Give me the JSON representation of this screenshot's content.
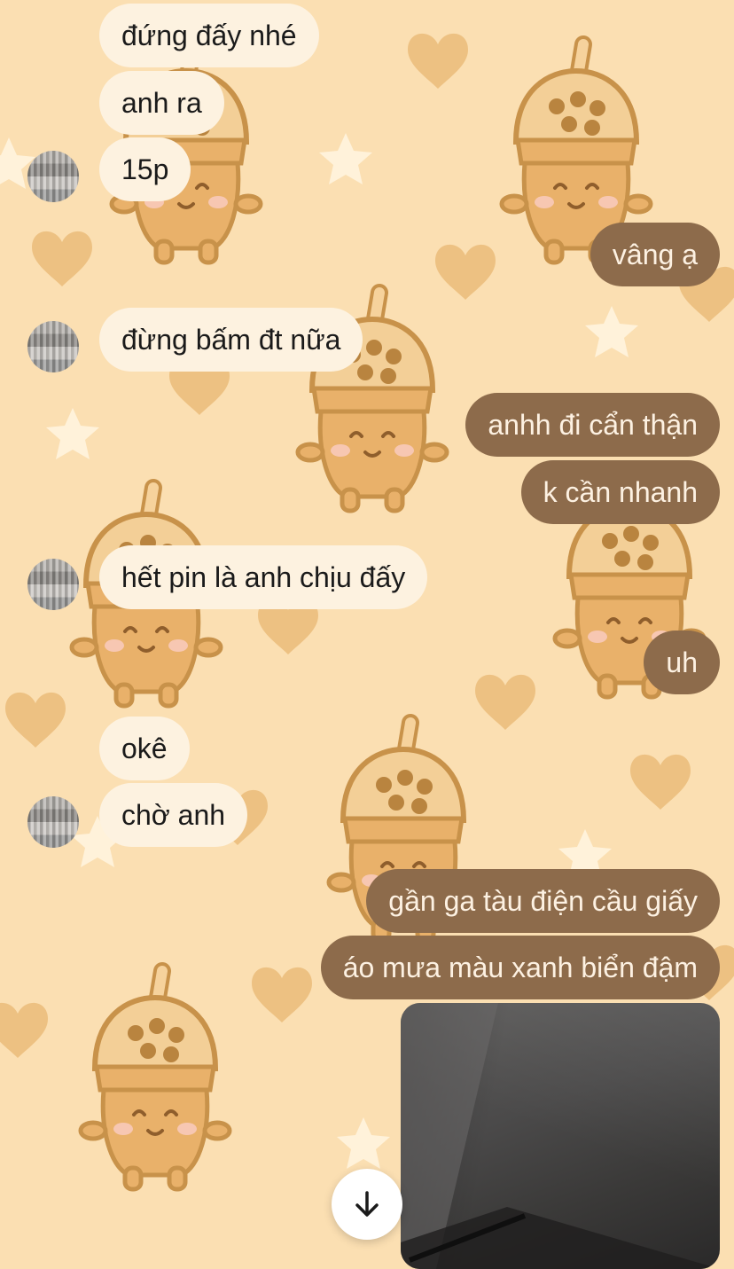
{
  "chat": {
    "messages": [
      {
        "dir": "in",
        "text": "đứng đấy nhé"
      },
      {
        "dir": "in",
        "text": "anh ra"
      },
      {
        "dir": "in",
        "text": "15p"
      },
      {
        "dir": "out",
        "text": "vâng ạ"
      },
      {
        "dir": "in",
        "text": "đừng bấm đt nữa"
      },
      {
        "dir": "out",
        "text": "anhh đi cẩn thận"
      },
      {
        "dir": "out",
        "text": "k cần nhanh"
      },
      {
        "dir": "in",
        "text": "hết pin là anh chịu đấy"
      },
      {
        "dir": "out",
        "text": "uh"
      },
      {
        "dir": "in",
        "text": "okê"
      },
      {
        "dir": "in",
        "text": "chờ anh"
      },
      {
        "dir": "out",
        "text": "gần ga tàu điện cầu giấy"
      },
      {
        "dir": "out",
        "text": "áo mưa màu xanh biển đậm"
      }
    ]
  },
  "colors": {
    "background": "#fbdfb2",
    "incoming_bubble": "#fdf2e0",
    "outgoing_bubble": "#8d6b4b",
    "outgoing_text": "#fdf1e2"
  },
  "icons": {
    "scroll_down": "arrow-down-icon",
    "avatar": "blurred-contact-avatar"
  }
}
